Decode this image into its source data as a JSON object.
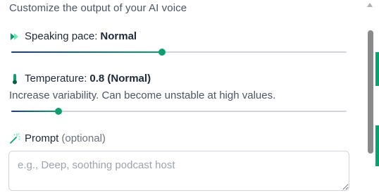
{
  "panel": {
    "subtitle": "Customize the output of your AI voice"
  },
  "speaking_pace": {
    "label": "Speaking pace:",
    "value": "Normal",
    "level": 0.45
  },
  "temperature": {
    "label": "Temperature:",
    "value": "0.8 (Normal)",
    "hint": "Increase variability. Can become unstable at high values.",
    "level": 0.14
  },
  "prompt": {
    "label": "Prompt",
    "optional": "(optional)",
    "placeholder": "e.g., Deep, soothing podcast host",
    "value": ""
  },
  "colors": {
    "accent": "#0e9f6e",
    "track": "#d1d5db",
    "gradient_start": "#1e3a8a",
    "text": "#1f2937",
    "muted": "#4b5563"
  },
  "icons": {
    "speaking_pace": "fast-forward-icon",
    "temperature": "thermometer-icon",
    "prompt": "magic-wand-icon"
  }
}
